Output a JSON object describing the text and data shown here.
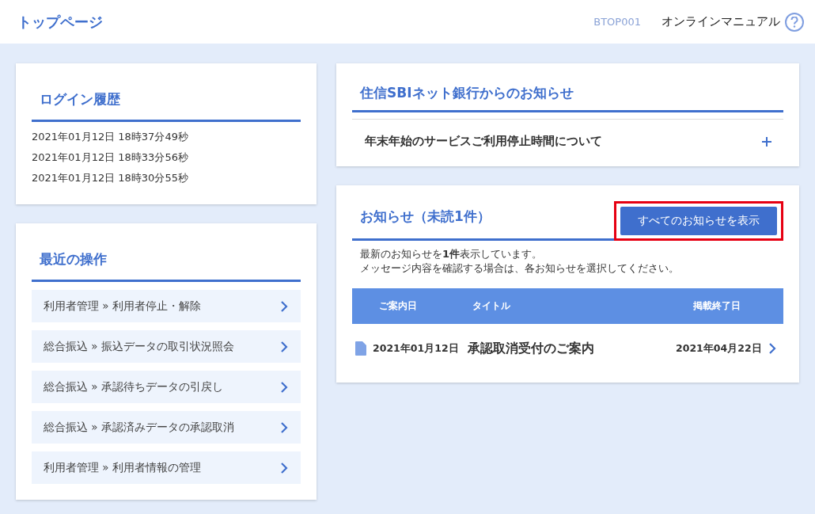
{
  "header": {
    "title": "トップページ",
    "screen_id": "BTOP001",
    "manual_link": "オンラインマニュアル"
  },
  "login_history": {
    "title": "ログイン履歴",
    "entries": [
      "2021年01月12日 18時37分49秒",
      "2021年01月12日 18時33分56秒",
      "2021年01月12日 18時30分55秒"
    ]
  },
  "recent_operations": {
    "title": "最近の操作",
    "items": [
      {
        "category": "利用者管理",
        "action": "利用者停止・解除",
        "separator": "»"
      },
      {
        "category": "総合振込",
        "action": "振込データの取引状況照会",
        "separator": "»"
      },
      {
        "category": "総合振込",
        "action": "承認待ちデータの引戻し",
        "separator": "»"
      },
      {
        "category": "総合振込",
        "action": "承認済みデータの承認取消",
        "separator": "»"
      },
      {
        "category": "利用者管理",
        "action": "利用者情報の管理",
        "separator": "»"
      }
    ]
  },
  "bank_notices": {
    "title": "住信SBIネット銀行からのお知らせ",
    "items": [
      {
        "title": "年末年始のサービスご利用停止時間について",
        "expanded": false
      }
    ]
  },
  "notices": {
    "title": "お知らせ（未読1件）",
    "show_all_button": {
      "label": "すべてのお知らせを表示",
      "highlighted": true
    },
    "description": [
      "最新のお知らせを**1件**表示しています。",
      "メッセージ内容を確認する場合は、各お知らせを選択してください。"
    ],
    "table": {
      "columns": [
        "ご案内日",
        "タイトル",
        "掲載終了日"
      ],
      "rows": [
        {
          "date": "2021年01月12日",
          "title": "承認取消受付のご案内",
          "end_date": "2021年04月22日"
        }
      ]
    }
  }
}
